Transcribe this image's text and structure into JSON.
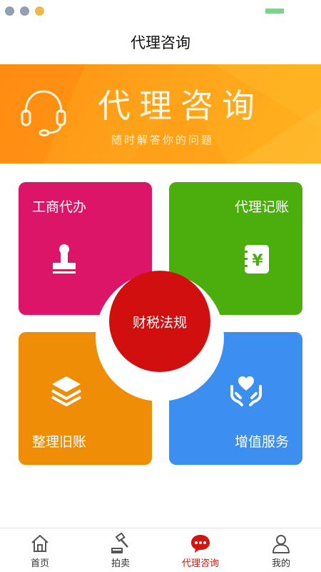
{
  "page": {
    "title": "代理咨询"
  },
  "banner": {
    "title": "代理咨询",
    "subtitle": "随时解答你的问题",
    "icon": "headset-icon"
  },
  "services": [
    {
      "label": "工商代办",
      "icon": "stamp-icon",
      "color": "#dd1568"
    },
    {
      "label": "代理记账",
      "icon": "ledger-yen-icon",
      "color": "#4bae0d"
    },
    {
      "label": "整理旧账",
      "icon": "layers-icon",
      "color": "#ef8d07"
    },
    {
      "label": "增值服务",
      "icon": "heart-hands-icon",
      "color": "#3c8ff0"
    }
  ],
  "center": {
    "label": "财税法规",
    "color": "#d10f0f"
  },
  "tabs": [
    {
      "label": "首页",
      "icon": "home-icon",
      "active": false
    },
    {
      "label": "拍卖",
      "icon": "auction-gavel-icon",
      "active": false
    },
    {
      "label": "代理咨询",
      "icon": "chat-bubble-icon",
      "active": true
    },
    {
      "label": "我的",
      "icon": "user-icon",
      "active": false
    }
  ],
  "colors": {
    "active_tab": "#d1160f",
    "banner": "#ff9a15"
  }
}
